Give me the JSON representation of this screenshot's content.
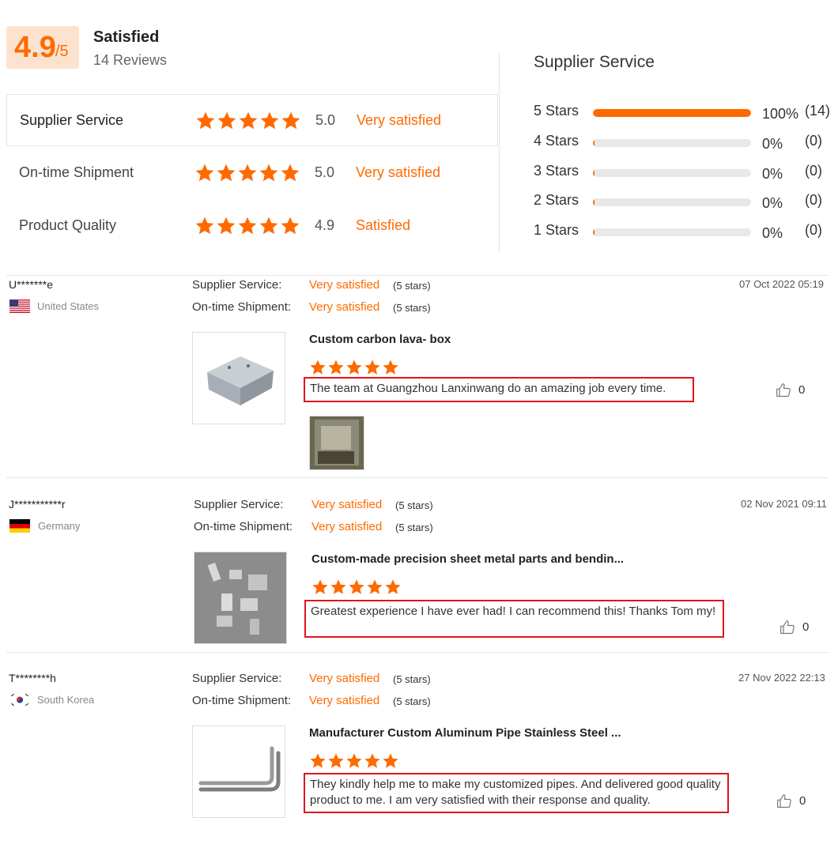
{
  "summary": {
    "score": "4.9",
    "score_max": "/5",
    "label": "Satisfied",
    "reviews": "14 Reviews"
  },
  "ratings": [
    {
      "name": "Supplier Service",
      "stars": 5,
      "value": "5.0",
      "word": "Very satisfied"
    },
    {
      "name": "On-time Shipment",
      "stars": 5,
      "value": "5.0",
      "word": "Very satisfied"
    },
    {
      "name": "Product Quality",
      "stars": 5,
      "value": "4.9",
      "word": "Satisfied"
    }
  ],
  "distribution": {
    "title": "Supplier Service",
    "rows": [
      {
        "label": "5 Stars",
        "fraction": 1.0,
        "pct": "100%",
        "count": "(14)"
      },
      {
        "label": "4 Stars",
        "fraction": 0.0,
        "pct": "0%",
        "count": "(0)"
      },
      {
        "label": "3 Stars",
        "fraction": 0.0,
        "pct": "0%",
        "count": "(0)"
      },
      {
        "label": "2 Stars",
        "fraction": 0.0,
        "pct": "0%",
        "count": "(0)"
      },
      {
        "label": "1 Stars",
        "fraction": 0.0,
        "pct": "0%",
        "count": "(0)"
      }
    ]
  },
  "reviews": [
    {
      "user": "U*******e",
      "country": "United States",
      "flag": "us",
      "ss_label": "Supplier Service:",
      "ss_value": "Very satisfied",
      "ss_stars": "(5 stars)",
      "os_label": "On-time Shipment:",
      "os_value": "Very satisfied",
      "os_stars": "(5 stars)",
      "date": "07 Oct 2022 05:19",
      "product": "Custom carbon lava- box",
      "rating": 5,
      "comment": "The team at Guangzhou Lanxinwang do an amazing job every time.",
      "likes": "0"
    },
    {
      "user": "J***********r",
      "country": "Germany",
      "flag": "de",
      "ss_label": "Supplier Service:",
      "ss_value": "Very satisfied",
      "ss_stars": "(5 stars)",
      "os_label": "On-time Shipment:",
      "os_value": "Very satisfied",
      "os_stars": "(5 stars)",
      "date": "02 Nov 2021 09:11",
      "product": "Custom-made precision sheet metal parts and bendin...",
      "rating": 5,
      "comment": "Greatest experience I have ever had! I can recommend this! Thanks Tom my!",
      "likes": "0"
    },
    {
      "user": "T********h",
      "country": "South Korea",
      "flag": "kr",
      "ss_label": "Supplier Service:",
      "ss_value": "Very satisfied",
      "ss_stars": "(5 stars)",
      "os_label": "On-time Shipment:",
      "os_value": "Very satisfied",
      "os_stars": "(5 stars)",
      "date": "27 Nov 2022 22:13",
      "product": "Manufacturer Custom Aluminum Pipe Stainless Steel ...",
      "rating": 5,
      "comment": "They kindly help me to make my customized pipes. And delivered good quality product to me. I am very satisfied with their response and quality.",
      "likes": "0"
    }
  ],
  "colors": {
    "accent": "#ff6a00",
    "score_bg": "#fde3cf",
    "highlight_border": "#e0151d",
    "track": "#e8e8e8"
  },
  "icons": {
    "star": "star-icon",
    "like": "thumbs-up-icon",
    "flags": [
      "us-flag-icon",
      "germany-flag-icon",
      "south-korea-flag-icon"
    ]
  }
}
